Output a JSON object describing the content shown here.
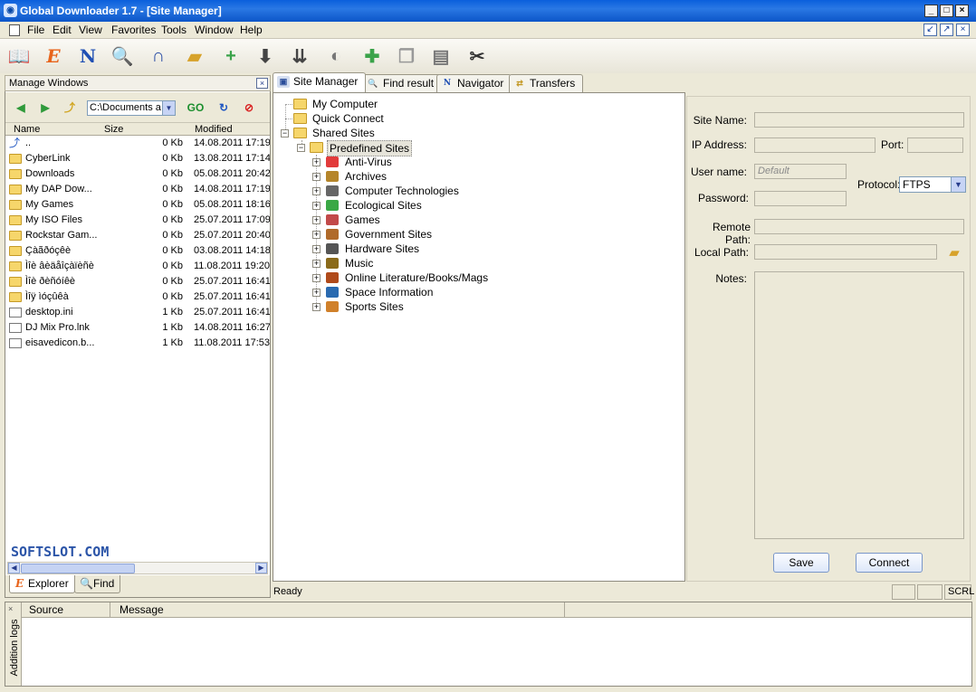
{
  "window": {
    "title": "Global Downloader 1.7 - [Site Manager]",
    "app_icon": "globe-icon"
  },
  "menu": [
    "File",
    "Edit",
    "View",
    "Favorites",
    "Tools",
    "Window",
    "Help"
  ],
  "toolbar_icons": [
    "book-icon",
    "explorer-e-icon",
    "navigator-n-icon",
    "magnifier-icon",
    "magnet-icon",
    "folder-open-icon",
    "add-page-icon",
    "download-arrow-icon",
    "download-multi-icon",
    "satellite-dish-icon",
    "edit-plus-icon",
    "copy-icon",
    "paste-icon",
    "scissors-icon"
  ],
  "left_panel": {
    "title": "Manage Windows",
    "path": "C:\\Documents a",
    "columns": {
      "name": "Name",
      "size": "Size",
      "modified": "Modified"
    },
    "files": [
      {
        "name": "..",
        "size": "0 Kb",
        "modified": "14.08.2011 17:19",
        "icon": "up-arrow-icon"
      },
      {
        "name": "CyberLink",
        "size": "0 Kb",
        "modified": "13.08.2011 17:14",
        "icon": "folder-icon"
      },
      {
        "name": "Downloads",
        "size": "0 Kb",
        "modified": "05.08.2011 20:42",
        "icon": "folder-icon"
      },
      {
        "name": "My DAP Dow...",
        "size": "0 Kb",
        "modified": "14.08.2011 17:19",
        "icon": "folder-icon"
      },
      {
        "name": "My Games",
        "size": "0 Kb",
        "modified": "05.08.2011 18:16",
        "icon": "folder-icon"
      },
      {
        "name": "My ISO Files",
        "size": "0 Kb",
        "modified": "25.07.2011 17:09",
        "icon": "folder-icon"
      },
      {
        "name": "Rockstar Gam...",
        "size": "0 Kb",
        "modified": "25.07.2011 20:40",
        "icon": "folder-icon"
      },
      {
        "name": "Çàãðóçêè",
        "size": "0 Kb",
        "modified": "03.08.2011 14:18",
        "icon": "folder-icon"
      },
      {
        "name": "Ìîè âèäåîçàïèñè",
        "size": "0 Kb",
        "modified": "11.08.2011 19:20",
        "icon": "folder-icon"
      },
      {
        "name": "Ìîè ðèñóíêè",
        "size": "0 Kb",
        "modified": "25.07.2011 16:41",
        "icon": "folder-icon"
      },
      {
        "name": "Ìîÿ ìóçûêà",
        "size": "0 Kb",
        "modified": "25.07.2011 16:41",
        "icon": "folder-icon"
      },
      {
        "name": "desktop.ini",
        "size": "1 Kb",
        "modified": "25.07.2011 16:41",
        "icon": "settings-file-icon"
      },
      {
        "name": "DJ Mix Pro.lnk",
        "size": "1 Kb",
        "modified": "14.08.2011 16:27",
        "icon": "shortcut-file-icon"
      },
      {
        "name": "eisavedicon.b...",
        "size": "1 Kb",
        "modified": "11.08.2011 17:53",
        "icon": "ps-file-icon"
      }
    ],
    "watermark": "SOFTSLOT.COM",
    "tabs": [
      "Explorer",
      "Find"
    ]
  },
  "main_tabs": [
    "Site Manager",
    "Find result",
    "Navigator",
    "Transfers"
  ],
  "tree": {
    "roots": [
      "My Computer",
      "Quick Connect",
      "Shared Sites"
    ],
    "predefined": "Predefined Sites",
    "categories": [
      {
        "label": "Anti-Virus",
        "icon": "red-cross-icon"
      },
      {
        "label": "Archives",
        "icon": "archive-icon"
      },
      {
        "label": "Computer Technologies",
        "icon": "binary-icon"
      },
      {
        "label": "Ecological Sites",
        "icon": "green-leaf-icon"
      },
      {
        "label": "Games",
        "icon": "cards-icon"
      },
      {
        "label": "Government Sites",
        "icon": "building-icon"
      },
      {
        "label": "Hardware Sites",
        "icon": "hardware-icon"
      },
      {
        "label": "Music",
        "icon": "note-icon"
      },
      {
        "label": "Online Literature/Books/Mags",
        "icon": "books-icon"
      },
      {
        "label": "Space Information",
        "icon": "planet-icon"
      },
      {
        "label": "Sports Sites",
        "icon": "ball-icon"
      }
    ]
  },
  "form": {
    "site_name_label": "Site Name:",
    "ip_label": "IP Address:",
    "port_label": "Port:",
    "user_label": "User name:",
    "user_placeholder": "Default",
    "password_label": "Password:",
    "protocol_label": "Protocol:",
    "protocol_value": "FTPS",
    "remote_label": "Remote Path:",
    "local_label": "Local Path:",
    "notes_label": "Notes:",
    "save": "Save",
    "connect": "Connect"
  },
  "status": {
    "text": "Ready",
    "scrl": "SCRL"
  },
  "log": {
    "side_label": "Addition logs",
    "columns": [
      "Source",
      "Message"
    ]
  }
}
